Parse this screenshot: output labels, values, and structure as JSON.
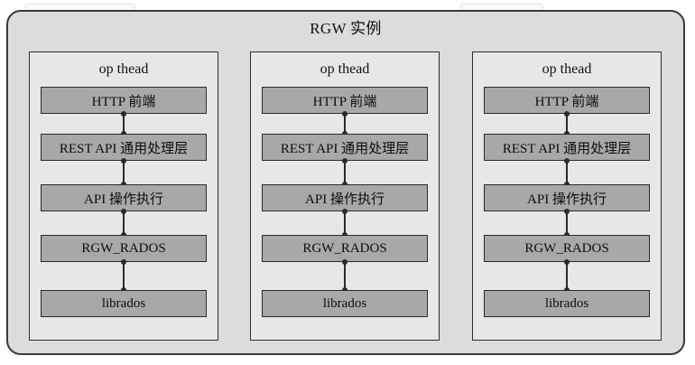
{
  "instance": {
    "title": "RGW 实例"
  },
  "threads": [
    {
      "title": "op thead",
      "layers": [
        "HTTP 前端",
        "REST API 通用处理层",
        "API 操作执行",
        "RGW_RADOS",
        "librados"
      ]
    },
    {
      "title": "op thead",
      "layers": [
        "HTTP 前端",
        "REST API 通用处理层",
        "API 操作执行",
        "RGW_RADOS",
        "librados"
      ]
    },
    {
      "title": "op thead",
      "layers": [
        "HTTP 前端",
        "REST API 通用处理层",
        "API 操作执行",
        "RGW_RADOS",
        "librados"
      ]
    }
  ],
  "colors": {
    "frame_fill": "#dcdcdc",
    "panel_fill": "#e7e7e7",
    "layer_fill": "#a8a8a8",
    "stroke": "#2a2a2a"
  }
}
